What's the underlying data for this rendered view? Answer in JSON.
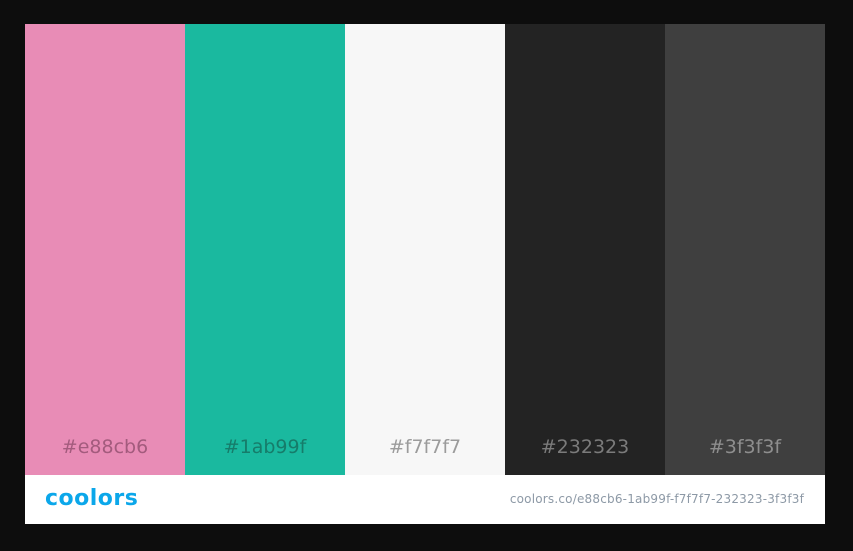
{
  "palette": {
    "swatches": [
      {
        "hex": "#e88cb6",
        "color": "#e88cb6",
        "text_color": "#a35b7d"
      },
      {
        "hex": "#1ab99f",
        "color": "#1ab99f",
        "text_color": "#167c6a"
      },
      {
        "hex": "#f7f7f7",
        "color": "#f7f7f7",
        "text_color": "#9b9b9b"
      },
      {
        "hex": "#232323",
        "color": "#232323",
        "text_color": "#7b7b7b"
      },
      {
        "hex": "#3f3f3f",
        "color": "#3f3f3f",
        "text_color": "#8e8e8e"
      }
    ]
  },
  "footer": {
    "logo_text": "coolors",
    "logo_color": "#0ba7ea",
    "url": "coolors.co/e88cb6-1ab99f-f7f7f7-232323-3f3f3f"
  },
  "page_background": "#0d0d0d"
}
